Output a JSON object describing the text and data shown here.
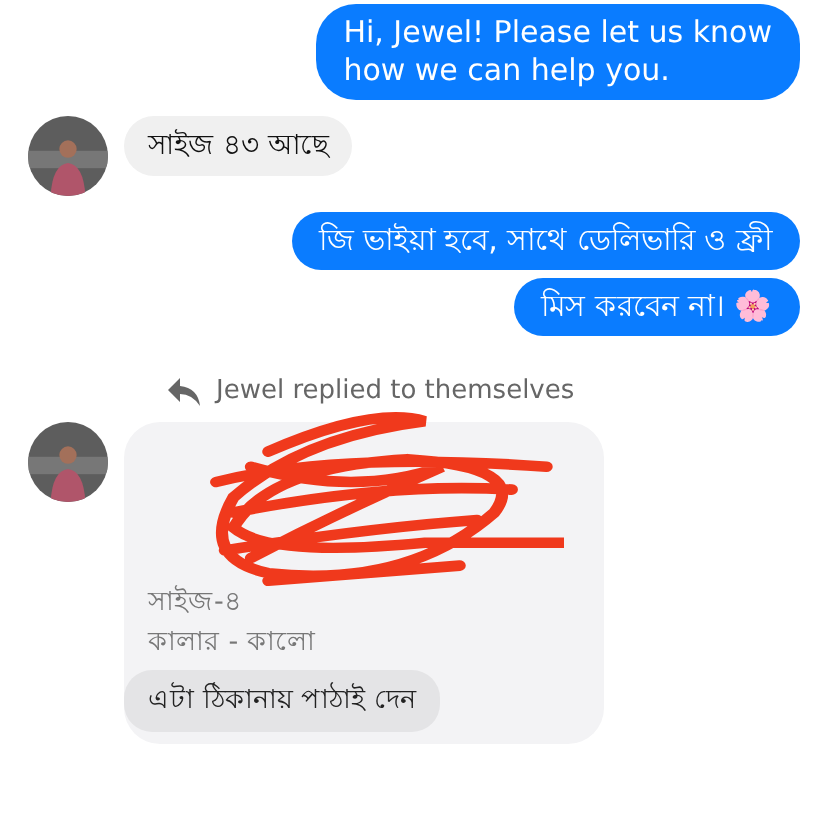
{
  "messages": [
    {
      "kind": "outgoing",
      "lines": [
        "Hi, Jewel! Please let us know",
        "how we can help you."
      ]
    },
    {
      "kind": "incoming",
      "avatar": true,
      "lines": [
        "সাইজ ৪৩ আছে"
      ]
    },
    {
      "kind": "outgoing",
      "lines": [
        "জি ভাইয়া হবে, সাথে ডেলিভারি ও ফ্রী"
      ]
    },
    {
      "kind": "outgoing",
      "lines": [
        "মিস করবেন না। 🌸"
      ]
    },
    {
      "kind": "reply_label",
      "text": "Jewel replied to themselves"
    },
    {
      "kind": "quoted",
      "avatar": true,
      "redacted": true,
      "lines": [
        "সাইজ-৪",
        "কালার - কালো"
      ],
      "reply": "এটা ঠিকানায় পাঠাই দেন"
    }
  ]
}
